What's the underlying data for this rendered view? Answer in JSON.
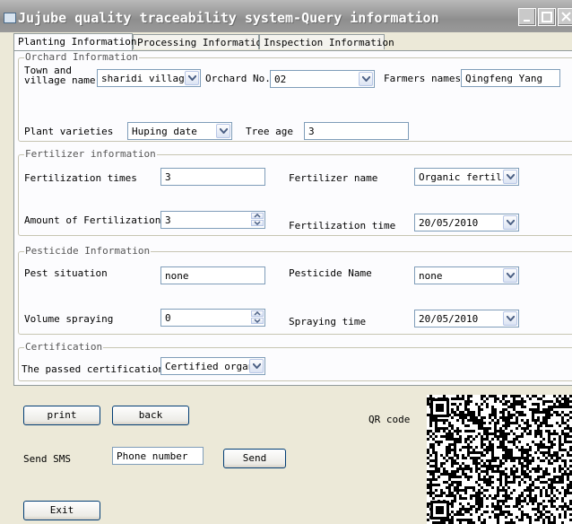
{
  "window": {
    "title": "Jujube quality traceability system-Query information"
  },
  "tabs": [
    {
      "label": "Planting Information",
      "active": true
    },
    {
      "label": "Processing Information",
      "active": false
    },
    {
      "label": "Inspection Information",
      "active": false
    }
  ],
  "orchard": {
    "group_title": "Orchard Information",
    "town_label_line1": "Town and",
    "town_label_line2": "village name",
    "town_value": "sharidi village",
    "orchard_no_label": "Orchard No.",
    "orchard_no_value": "02",
    "farmers_label": "Farmers names",
    "farmers_value": "Qingfeng Yang",
    "varieties_label": "Plant varieties",
    "varieties_value": "Huping date",
    "tree_age_label": "Tree age",
    "tree_age_value": "3"
  },
  "fertilizer": {
    "group_title": "Fertilizer information",
    "times_label": "Fertilization times",
    "times_value": "3",
    "name_label": "Fertilizer name",
    "name_value": "Organic fertili:",
    "amount_label": "Amount of  Fertilization",
    "amount_value": "3",
    "time_label": "Fertilization time",
    "time_value": "20/05/2010"
  },
  "pesticide": {
    "group_title": "Pesticide Information",
    "pest_label": "Pest situation",
    "pest_value": "none",
    "name_label": "Pesticide Name",
    "name_value": "none",
    "volume_label": "Volume spraying",
    "volume_value": "0",
    "time_label": "Spraying time",
    "time_value": "20/05/2010"
  },
  "certification": {
    "group_title": "Certification",
    "passed_label": "The passed certification",
    "passed_value": "Certified organi"
  },
  "bottom": {
    "print_label": "print",
    "back_label": "back",
    "qr_label": "QR code",
    "sms_label": "Send SMS",
    "phone_value": "Phone number",
    "send_label": "Send",
    "exit_label": "Exit"
  },
  "icons": {
    "app": "app-icon",
    "minimize": "minimize-icon",
    "maximize": "maximize-icon",
    "close": "close-icon",
    "dropdown": "chevron-down-icon",
    "spin_up": "spin-up-icon",
    "spin_down": "spin-down-icon"
  }
}
